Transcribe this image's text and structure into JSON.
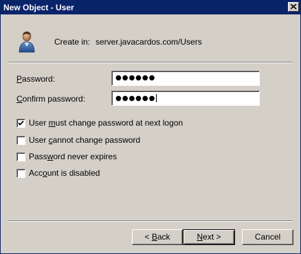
{
  "window": {
    "title": "New Object - User",
    "close_icon": "close-icon"
  },
  "header": {
    "icon": "user-icon",
    "create_in_label": "Create in:",
    "create_in_value": "server.javacardos.com/Users"
  },
  "fields": {
    "password": {
      "label_access_key": "P",
      "label_rest": "assword:",
      "value": "●●●●●●"
    },
    "confirm_password": {
      "label_access_key": "C",
      "label_rest": "onfirm password:",
      "value": "●●●●●●"
    }
  },
  "options": [
    {
      "before": "User ",
      "access_key": "m",
      "after": "ust change password at next logon",
      "checked": true
    },
    {
      "before": "User ",
      "access_key": "c",
      "after": "annot change password",
      "checked": false
    },
    {
      "before": "Pass",
      "access_key": "w",
      "after": "ord never expires",
      "checked": false
    },
    {
      "before": "Acc",
      "access_key": "o",
      "after": "unt is disabled",
      "checked": false
    }
  ],
  "buttons": {
    "back": {
      "prefix": "< ",
      "access_key": "B",
      "rest": "ack"
    },
    "next": {
      "access_key": "N",
      "rest": "ext >"
    },
    "cancel": {
      "label": "Cancel"
    }
  },
  "colors": {
    "titlebar": "#0a246a",
    "dialog_bg": "#d4d0c8",
    "title_text": "#ffffff"
  }
}
